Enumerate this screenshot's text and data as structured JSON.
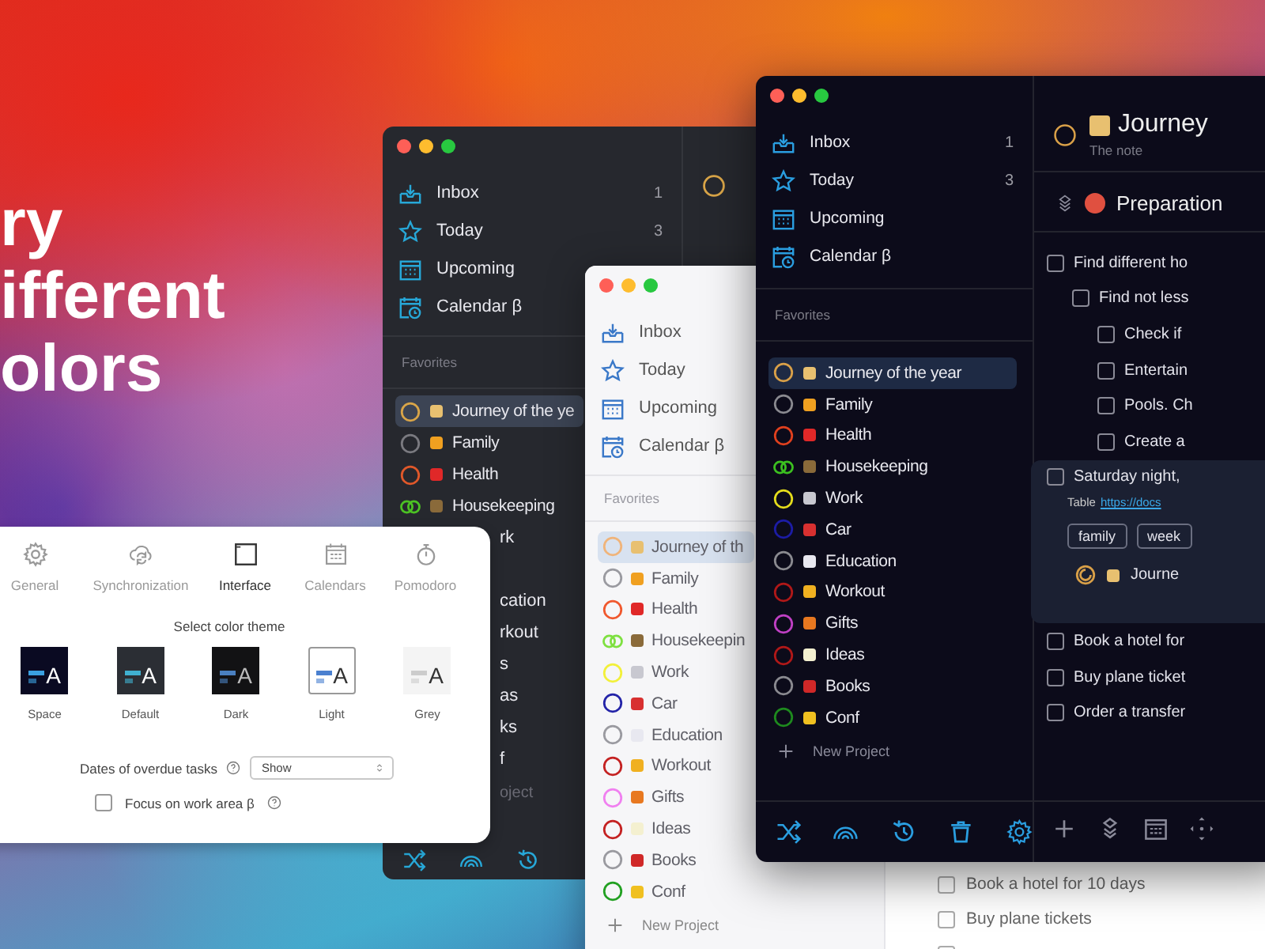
{
  "headline": [
    "ry",
    "ifferent",
    "olors"
  ],
  "window_back": {
    "nav": [
      {
        "label": "Inbox",
        "count": "1",
        "kind": "inbox"
      },
      {
        "label": "Today",
        "count": "3",
        "kind": "today"
      },
      {
        "label": "Upcoming",
        "kind": "upcoming"
      },
      {
        "label": "Calendar β",
        "kind": "calendar"
      }
    ],
    "favorites_label": "Favorites",
    "projects": [
      {
        "name": "Journey of the ye",
        "color": "#d9a548",
        "kind": "ring",
        "selected": true
      },
      {
        "name": "Family",
        "color": "#7a7a80",
        "kind": "ring",
        "selected": false
      },
      {
        "name": "Health",
        "color": "#e0582a",
        "kind": "ring",
        "selected": false
      },
      {
        "name": "Housekeeping",
        "color": "#4cc224",
        "kind": "double",
        "selected": false
      }
    ],
    "covered_rows": [
      "rk",
      "cation",
      "rkout",
      "s",
      "as",
      "ks",
      "f",
      "oject"
    ]
  },
  "window_middle": {
    "nav": [
      {
        "label": "Inbox",
        "kind": "inbox"
      },
      {
        "label": "Today",
        "kind": "today"
      },
      {
        "label": "Upcoming",
        "kind": "upcoming"
      },
      {
        "label": "Calendar β",
        "kind": "calendar"
      }
    ],
    "favorites_label": "Favorites",
    "projects": [
      {
        "name": "Journey of th",
        "color": "#f0b47a",
        "kind": "ring",
        "selected": true
      },
      {
        "name": "Family",
        "color": "#9a9aa0",
        "kind": "ring",
        "selected": false
      },
      {
        "name": "Health",
        "color": "#f0582e",
        "kind": "ring",
        "selected": false
      },
      {
        "name": "Housekeepin",
        "color": "#7ee040",
        "kind": "double",
        "selected": false
      },
      {
        "name": "Work",
        "color": "#f2f03a",
        "kind": "ring",
        "selected": false
      },
      {
        "name": "Car",
        "color": "#2424a8",
        "kind": "ring",
        "selected": false
      },
      {
        "name": "Education",
        "color": "#9a9aa0",
        "kind": "ring",
        "selected": false
      },
      {
        "name": "Workout",
        "color": "#c42222",
        "kind": "ring",
        "selected": false
      },
      {
        "name": "Gifts",
        "color": "#f080f0",
        "kind": "ring",
        "selected": false
      },
      {
        "name": "Ideas",
        "color": "#c42222",
        "kind": "ring",
        "selected": false
      },
      {
        "name": "Books",
        "color": "#9a9aa0",
        "kind": "ring",
        "selected": false
      },
      {
        "name": "Conf",
        "color": "#22a022",
        "kind": "ring",
        "selected": false
      }
    ],
    "new_project": "New Project",
    "tasks": [
      {
        "text": "Book a hotel for 10 days",
        "checked": false
      },
      {
        "text": "Buy plane tickets",
        "checked": false
      },
      {
        "checked": false
      }
    ]
  },
  "window_front": {
    "nav": [
      {
        "label": "Inbox",
        "count": "1",
        "kind": "inbox"
      },
      {
        "label": "Today",
        "count": "3",
        "kind": "today"
      },
      {
        "label": "Upcoming",
        "kind": "upcoming"
      },
      {
        "label": "Calendar β",
        "kind": "calendar"
      }
    ],
    "favorites_label": "Favorites",
    "projects": [
      {
        "name": "Journey of the year",
        "color": "#d9a048",
        "kind": "ring",
        "selected": true
      },
      {
        "name": "Family",
        "color": "#8a8a90",
        "kind": "ring",
        "selected": false
      },
      {
        "name": "Health",
        "color": "#e0401e",
        "kind": "ring",
        "selected": false
      },
      {
        "name": "Housekeeping",
        "color": "#3cc020",
        "kind": "double",
        "selected": false
      },
      {
        "name": "Work",
        "color": "#e4dc1c",
        "kind": "ring",
        "selected": false
      },
      {
        "name": "Car",
        "color": "#1c1ca4",
        "kind": "ring",
        "selected": false
      },
      {
        "name": "Education",
        "color": "#8a8a90",
        "kind": "ring",
        "selected": false
      },
      {
        "name": "Workout",
        "color": "#b01818",
        "kind": "ring",
        "selected": false
      },
      {
        "name": "Gifts",
        "color": "#c040c4",
        "kind": "ring",
        "selected": false
      },
      {
        "name": "Ideas",
        "color": "#b01818",
        "kind": "ring",
        "selected": false
      },
      {
        "name": "Books",
        "color": "#8a8a90",
        "kind": "ring",
        "selected": false
      },
      {
        "name": "Conf",
        "color": "#1e8a1e",
        "kind": "ring",
        "selected": false
      }
    ],
    "new_project": "New Project",
    "project_title": "Journey",
    "note": "The note",
    "section": "Preparation",
    "tasks": [
      {
        "text": "Find different ho",
        "checked": false,
        "children": [
          {
            "text": "Find not less",
            "checked": false,
            "children": [
              {
                "text": "Check if",
                "checked": false
              },
              {
                "text": "Entertain",
                "checked": false
              },
              {
                "text": "Pools. Ch",
                "checked": false
              },
              {
                "text": "Create a",
                "checked": false
              }
            ]
          }
        ]
      }
    ],
    "card": {
      "text": "Saturday night,",
      "checked": false,
      "note_label": "Table",
      "link": "https://docs",
      "tags": [
        "family",
        "week"
      ],
      "project": "Journe"
    },
    "more_tasks": [
      {
        "text": "Book a hotel for",
        "checked": false
      },
      {
        "text": "Buy plane ticket",
        "checked": false
      },
      {
        "text": "Order a transfer",
        "checked": false
      }
    ]
  },
  "settings": {
    "tabs": [
      {
        "label": "General",
        "kind": "gear",
        "selected": false
      },
      {
        "label": "Synchronization",
        "kind": "sync",
        "selected": false
      },
      {
        "label": "Interface",
        "kind": "window",
        "selected": true
      },
      {
        "label": "Calendars",
        "kind": "calendar",
        "selected": false
      },
      {
        "label": "Pomodoro",
        "kind": "timer",
        "selected": false
      }
    ],
    "theme_heading": "Select color theme",
    "themes": [
      {
        "label": "Space",
        "kind": "space",
        "sample": "A",
        "selected": false
      },
      {
        "label": "Default",
        "kind": "default",
        "sample": "A",
        "selected": false
      },
      {
        "label": "Dark",
        "kind": "dark",
        "sample": "A",
        "selected": false
      },
      {
        "label": "Light",
        "kind": "light",
        "sample": "A",
        "selected": true
      },
      {
        "label": "Grey",
        "kind": "grey",
        "sample": "A",
        "selected": false
      }
    ],
    "overdue": {
      "label": "Dates of overdue tasks",
      "value": "Show"
    },
    "focus": {
      "label": "Focus on work area β",
      "checked": false
    }
  }
}
